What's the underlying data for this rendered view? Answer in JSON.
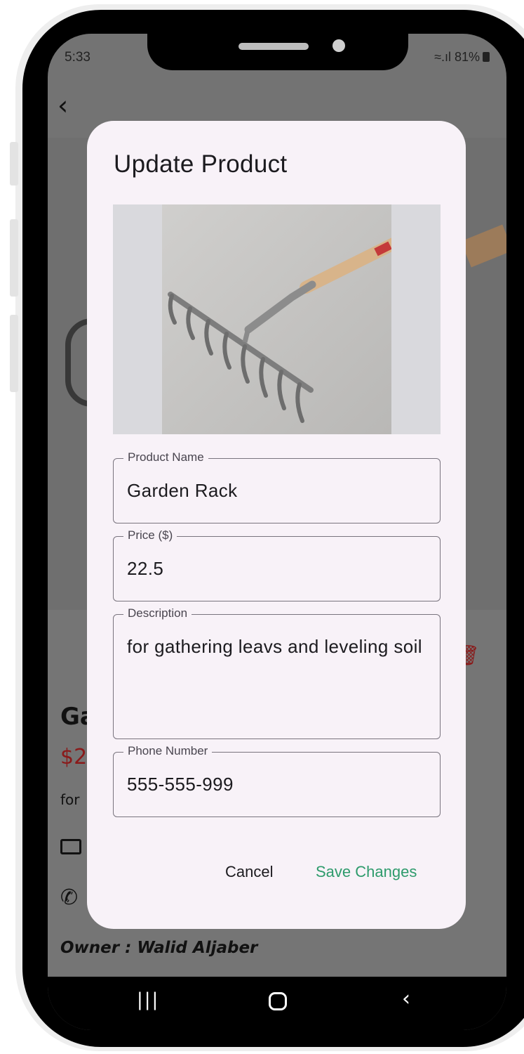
{
  "status_bar": {
    "time": "5:33",
    "battery": "81%"
  },
  "background": {
    "product_title_partial": "Ga",
    "price_partial": "$2",
    "description_partial": "for",
    "owner": "Owner : Walid Aljaber"
  },
  "dialog": {
    "title": "Update Product",
    "image_icon": "garden-rake-photo",
    "fields": {
      "product_name": {
        "label": "Product Name",
        "value": "Garden Rack"
      },
      "price": {
        "label": "Price ($)",
        "value": "22.5"
      },
      "description": {
        "label": "Description",
        "value": "for gathering leavs and leveling soil"
      },
      "phone": {
        "label": "Phone Number",
        "value": "555-555-999"
      }
    },
    "buttons": {
      "cancel": "Cancel",
      "save": "Save Changes"
    }
  },
  "colors": {
    "accent": "#2e9b6c",
    "dialog_bg": "#f8f2f8",
    "scrim": "#737373",
    "danger": "#8a1a1a"
  }
}
